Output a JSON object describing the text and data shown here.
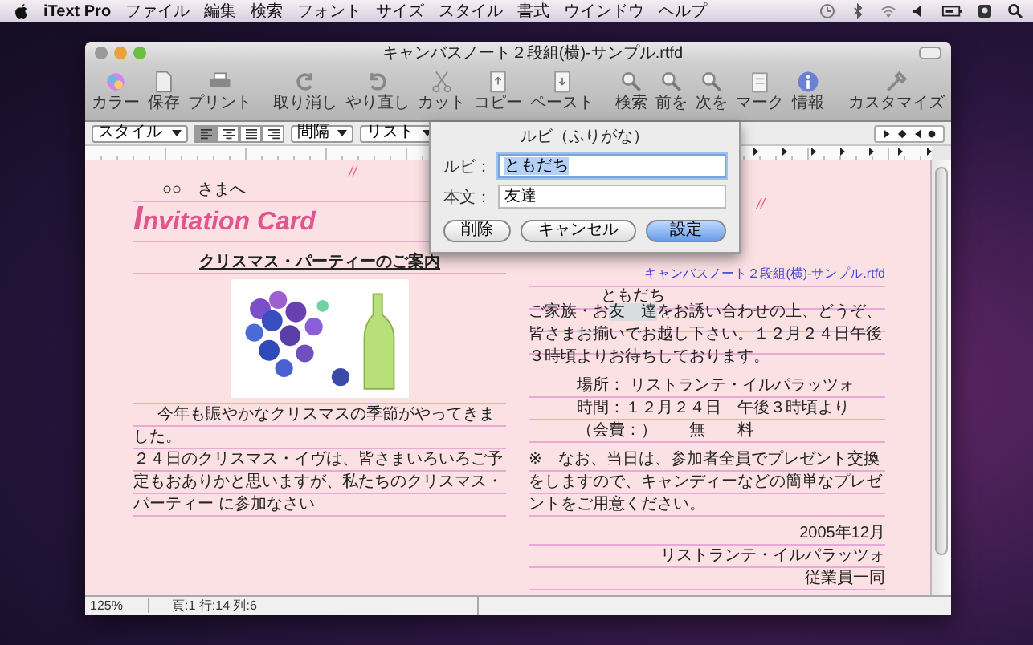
{
  "menubar": {
    "app": "iText Pro",
    "items": [
      "ファイル",
      "編集",
      "検索",
      "フォント",
      "サイズ",
      "スタイル",
      "書式",
      "ウインドウ",
      "ヘルプ"
    ]
  },
  "window": {
    "title": "キャンバスノート２段組(横)-サンプル.rtfd"
  },
  "toolbar": [
    {
      "kind": "color",
      "label": "カラー"
    },
    {
      "kind": "save",
      "label": "保存"
    },
    {
      "kind": "print",
      "label": "プリント"
    },
    {
      "kind": "undo",
      "label": "取り消し"
    },
    {
      "kind": "redo",
      "label": "やり直し"
    },
    {
      "kind": "cut",
      "label": "カット"
    },
    {
      "kind": "copy",
      "label": "コピー"
    },
    {
      "kind": "paste",
      "label": "ペースト"
    },
    {
      "kind": "find",
      "label": "検索"
    },
    {
      "kind": "prev",
      "label": "前を"
    },
    {
      "kind": "next",
      "label": "次を"
    },
    {
      "kind": "mark",
      "label": "マーク"
    },
    {
      "kind": "info",
      "label": "情報"
    },
    {
      "kind": "customize",
      "label": "カスタマイズ"
    }
  ],
  "format_bar": {
    "style": "スタイル",
    "alignments": [
      {
        "selected": true
      },
      {
        "selected": false
      },
      {
        "selected": false
      },
      {
        "selected": false
      }
    ],
    "spacing": "間隔",
    "list": "リスト"
  },
  "dialog": {
    "title": "ルビ（ふりがな）",
    "fields": [
      {
        "label": "ルビ：",
        "value": "ともだち",
        "focused": true
      },
      {
        "label": "本文：",
        "value": "友達",
        "focused": false
      }
    ],
    "buttons": [
      {
        "label": "削除",
        "default": false
      },
      {
        "label": "キャンセル",
        "default": false
      },
      {
        "label": "設定",
        "default": true
      }
    ]
  },
  "document": {
    "marks": [
      "//",
      "//"
    ],
    "left": {
      "greeting": "○○　さまへ",
      "title": "Invitation Card",
      "heading": "クリスマス・パーティーのご案内",
      "body": [
        "今年も賑やかなクリスマスの季節がやってきました。",
        "２４日のクリスマス・イヴは、皆さまいろいろご予定もおありかと思いますが、私たちのクリスマス・パーティー に参加なさい"
      ]
    },
    "right": {
      "filename": "キャンバスノート２段組(横)-サンプル.rtfd",
      "paragraph": {
        "before": "ご家族・お",
        "base": "友達",
        "ruby": "ともだち",
        "after": "をお誘い合わせの上、どうぞ、皆さまお揃いでお越し下さい。１２月２４日午後３時頃よりお待ちしております。"
      },
      "details": [
        "場所：  リストランテ・イルパラッツォ",
        "時間：１２月２４日　午後３時頃より",
        "（会費：）　　無　　料"
      ],
      "note": "※　なお、当日は、参加者全員でプレゼント交換をしますので、キャンディーなどの簡単なプレゼントをご用意ください。",
      "signature": [
        "2005年12月",
        "リストランテ・イルパラッツォ",
        "従業員一同"
      ]
    }
  },
  "status_bar": {
    "zoom": "125%",
    "position": "頁:1 行:14 列:6"
  }
}
